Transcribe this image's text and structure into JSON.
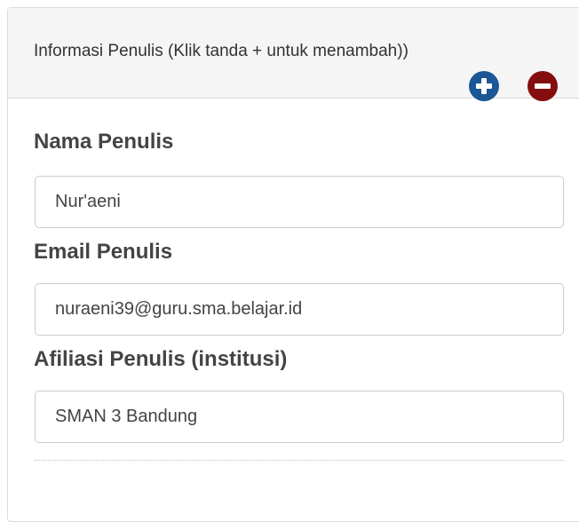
{
  "panel": {
    "title": "Informasi Penulis (Klik tanda + untuk menambah))",
    "add_icon": "plus-circle-icon",
    "remove_icon": "minus-circle-icon",
    "add_color": "#1a5794",
    "remove_color": "#840d0d"
  },
  "fields": {
    "name": {
      "label": "Nama Penulis",
      "value": "Nur'aeni"
    },
    "email": {
      "label": "Email Penulis",
      "value": "nuraeni39@guru.sma.belajar.id"
    },
    "affiliation": {
      "label": "Afiliasi Penulis (institusi)",
      "value": "SMAN 3 Bandung"
    }
  }
}
